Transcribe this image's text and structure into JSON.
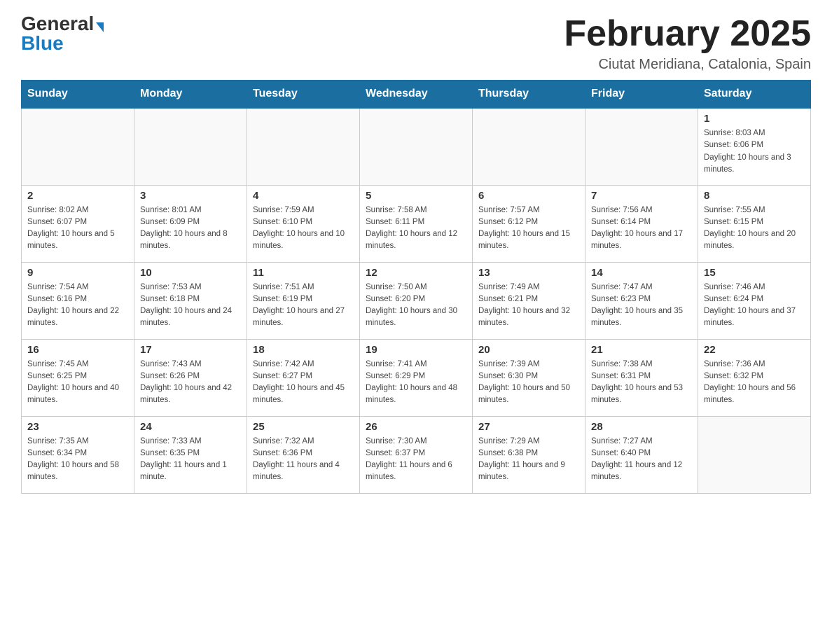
{
  "logo": {
    "general": "General",
    "blue": "Blue"
  },
  "header": {
    "month": "February 2025",
    "location": "Ciutat Meridiana, Catalonia, Spain"
  },
  "weekdays": [
    "Sunday",
    "Monday",
    "Tuesday",
    "Wednesday",
    "Thursday",
    "Friday",
    "Saturday"
  ],
  "weeks": [
    [
      {
        "day": "",
        "sunrise": "",
        "sunset": "",
        "daylight": ""
      },
      {
        "day": "",
        "sunrise": "",
        "sunset": "",
        "daylight": ""
      },
      {
        "day": "",
        "sunrise": "",
        "sunset": "",
        "daylight": ""
      },
      {
        "day": "",
        "sunrise": "",
        "sunset": "",
        "daylight": ""
      },
      {
        "day": "",
        "sunrise": "",
        "sunset": "",
        "daylight": ""
      },
      {
        "day": "",
        "sunrise": "",
        "sunset": "",
        "daylight": ""
      },
      {
        "day": "1",
        "sunrise": "Sunrise: 8:03 AM",
        "sunset": "Sunset: 6:06 PM",
        "daylight": "Daylight: 10 hours and 3 minutes."
      }
    ],
    [
      {
        "day": "2",
        "sunrise": "Sunrise: 8:02 AM",
        "sunset": "Sunset: 6:07 PM",
        "daylight": "Daylight: 10 hours and 5 minutes."
      },
      {
        "day": "3",
        "sunrise": "Sunrise: 8:01 AM",
        "sunset": "Sunset: 6:09 PM",
        "daylight": "Daylight: 10 hours and 8 minutes."
      },
      {
        "day": "4",
        "sunrise": "Sunrise: 7:59 AM",
        "sunset": "Sunset: 6:10 PM",
        "daylight": "Daylight: 10 hours and 10 minutes."
      },
      {
        "day": "5",
        "sunrise": "Sunrise: 7:58 AM",
        "sunset": "Sunset: 6:11 PM",
        "daylight": "Daylight: 10 hours and 12 minutes."
      },
      {
        "day": "6",
        "sunrise": "Sunrise: 7:57 AM",
        "sunset": "Sunset: 6:12 PM",
        "daylight": "Daylight: 10 hours and 15 minutes."
      },
      {
        "day": "7",
        "sunrise": "Sunrise: 7:56 AM",
        "sunset": "Sunset: 6:14 PM",
        "daylight": "Daylight: 10 hours and 17 minutes."
      },
      {
        "day": "8",
        "sunrise": "Sunrise: 7:55 AM",
        "sunset": "Sunset: 6:15 PM",
        "daylight": "Daylight: 10 hours and 20 minutes."
      }
    ],
    [
      {
        "day": "9",
        "sunrise": "Sunrise: 7:54 AM",
        "sunset": "Sunset: 6:16 PM",
        "daylight": "Daylight: 10 hours and 22 minutes."
      },
      {
        "day": "10",
        "sunrise": "Sunrise: 7:53 AM",
        "sunset": "Sunset: 6:18 PM",
        "daylight": "Daylight: 10 hours and 24 minutes."
      },
      {
        "day": "11",
        "sunrise": "Sunrise: 7:51 AM",
        "sunset": "Sunset: 6:19 PM",
        "daylight": "Daylight: 10 hours and 27 minutes."
      },
      {
        "day": "12",
        "sunrise": "Sunrise: 7:50 AM",
        "sunset": "Sunset: 6:20 PM",
        "daylight": "Daylight: 10 hours and 30 minutes."
      },
      {
        "day": "13",
        "sunrise": "Sunrise: 7:49 AM",
        "sunset": "Sunset: 6:21 PM",
        "daylight": "Daylight: 10 hours and 32 minutes."
      },
      {
        "day": "14",
        "sunrise": "Sunrise: 7:47 AM",
        "sunset": "Sunset: 6:23 PM",
        "daylight": "Daylight: 10 hours and 35 minutes."
      },
      {
        "day": "15",
        "sunrise": "Sunrise: 7:46 AM",
        "sunset": "Sunset: 6:24 PM",
        "daylight": "Daylight: 10 hours and 37 minutes."
      }
    ],
    [
      {
        "day": "16",
        "sunrise": "Sunrise: 7:45 AM",
        "sunset": "Sunset: 6:25 PM",
        "daylight": "Daylight: 10 hours and 40 minutes."
      },
      {
        "day": "17",
        "sunrise": "Sunrise: 7:43 AM",
        "sunset": "Sunset: 6:26 PM",
        "daylight": "Daylight: 10 hours and 42 minutes."
      },
      {
        "day": "18",
        "sunrise": "Sunrise: 7:42 AM",
        "sunset": "Sunset: 6:27 PM",
        "daylight": "Daylight: 10 hours and 45 minutes."
      },
      {
        "day": "19",
        "sunrise": "Sunrise: 7:41 AM",
        "sunset": "Sunset: 6:29 PM",
        "daylight": "Daylight: 10 hours and 48 minutes."
      },
      {
        "day": "20",
        "sunrise": "Sunrise: 7:39 AM",
        "sunset": "Sunset: 6:30 PM",
        "daylight": "Daylight: 10 hours and 50 minutes."
      },
      {
        "day": "21",
        "sunrise": "Sunrise: 7:38 AM",
        "sunset": "Sunset: 6:31 PM",
        "daylight": "Daylight: 10 hours and 53 minutes."
      },
      {
        "day": "22",
        "sunrise": "Sunrise: 7:36 AM",
        "sunset": "Sunset: 6:32 PM",
        "daylight": "Daylight: 10 hours and 56 minutes."
      }
    ],
    [
      {
        "day": "23",
        "sunrise": "Sunrise: 7:35 AM",
        "sunset": "Sunset: 6:34 PM",
        "daylight": "Daylight: 10 hours and 58 minutes."
      },
      {
        "day": "24",
        "sunrise": "Sunrise: 7:33 AM",
        "sunset": "Sunset: 6:35 PM",
        "daylight": "Daylight: 11 hours and 1 minute."
      },
      {
        "day": "25",
        "sunrise": "Sunrise: 7:32 AM",
        "sunset": "Sunset: 6:36 PM",
        "daylight": "Daylight: 11 hours and 4 minutes."
      },
      {
        "day": "26",
        "sunrise": "Sunrise: 7:30 AM",
        "sunset": "Sunset: 6:37 PM",
        "daylight": "Daylight: 11 hours and 6 minutes."
      },
      {
        "day": "27",
        "sunrise": "Sunrise: 7:29 AM",
        "sunset": "Sunset: 6:38 PM",
        "daylight": "Daylight: 11 hours and 9 minutes."
      },
      {
        "day": "28",
        "sunrise": "Sunrise: 7:27 AM",
        "sunset": "Sunset: 6:40 PM",
        "daylight": "Daylight: 11 hours and 12 minutes."
      },
      {
        "day": "",
        "sunrise": "",
        "sunset": "",
        "daylight": ""
      }
    ]
  ]
}
